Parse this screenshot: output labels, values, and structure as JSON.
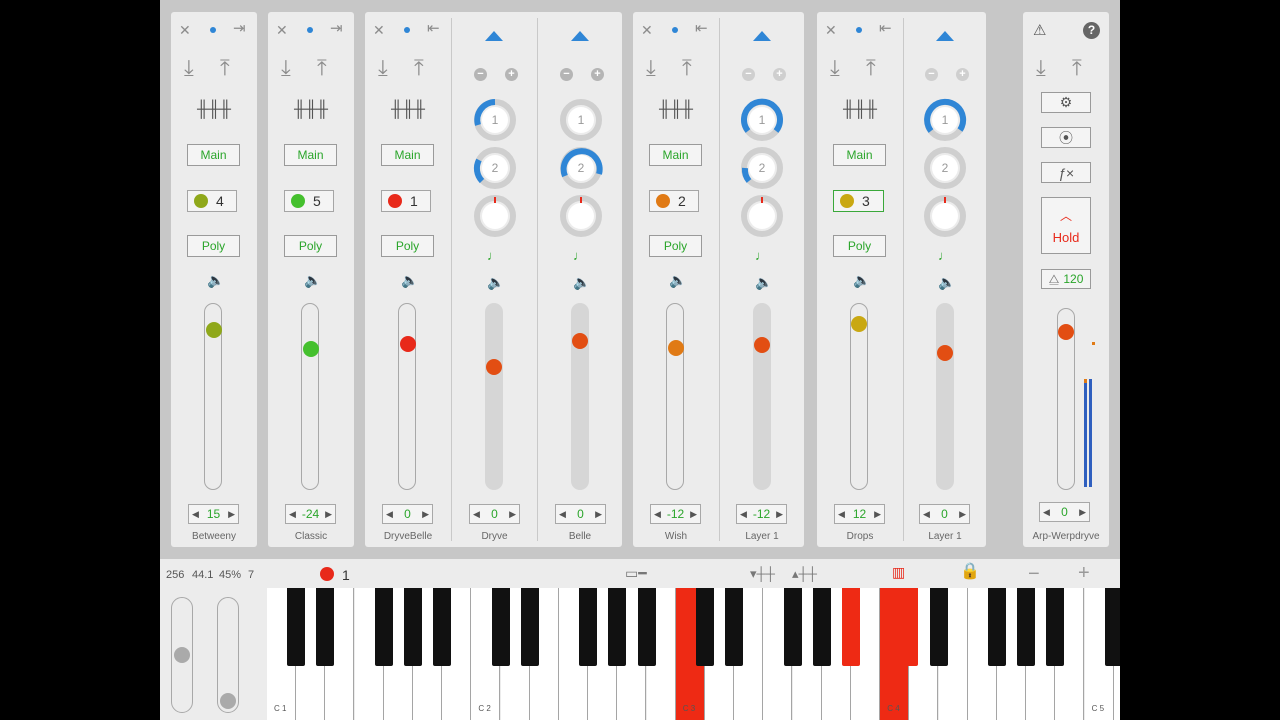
{
  "strips": [
    {
      "id": "betweeny",
      "name": "Betweeny",
      "output": "Main",
      "channel": "4",
      "channel_color": "#8fa81a",
      "mode": "Poly",
      "level": 0.83,
      "knob_color": "#8fa81a",
      "step": "15"
    },
    {
      "id": "classic",
      "name": "Classic",
      "output": "Main",
      "channel": "5",
      "channel_color": "#45c02e",
      "mode": "Poly",
      "level": 0.76,
      "knob_color": "#45c02e",
      "step": "-24"
    },
    {
      "id": "dryvebelle",
      "name": "DryveBelle",
      "output": "Main",
      "channel": "1",
      "channel_color": "#e8291a",
      "mode": "Poly",
      "level": 0.77,
      "knob_color": "#e8291a",
      "step": "0"
    },
    {
      "id": "wish",
      "name": "Wish",
      "output": "Main",
      "channel": "2",
      "channel_color": "#e07a15",
      "mode": "Poly",
      "level": 0.75,
      "knob_color": "#e07a15",
      "step": "-12"
    },
    {
      "id": "drops",
      "name": "Drops",
      "output": "Main",
      "channel": "3",
      "channel_color": "#c9a812",
      "mode": "Poly",
      "level": 0.88,
      "knob_color": "#c9a812",
      "step": "12",
      "selected": true
    }
  ],
  "layers": [
    {
      "id": "dryve",
      "name": "Dryve",
      "knob1": "1",
      "knob2": "2",
      "level": 0.67,
      "step": "0"
    },
    {
      "id": "belle",
      "name": "Belle",
      "knob1": "1",
      "knob2": "2",
      "level": 0.79,
      "step": "0"
    },
    {
      "id": "layer1a",
      "name": "Layer 1",
      "knob1": "1",
      "knob2": "2",
      "level": 0.79,
      "step": "-12"
    },
    {
      "id": "layer1b",
      "name": "Layer 1",
      "knob1": "1",
      "knob2": "2",
      "level": 0.74,
      "step": "0"
    }
  ],
  "arp": {
    "name": "Arp-Werpdryve",
    "hold_label": "Hold",
    "tempo": "120",
    "level": 0.87,
    "step": "0"
  },
  "status": {
    "buffer": "256",
    "rate": "44.1",
    "cpu": "45%",
    "voices": "7",
    "channel": "1",
    "channel_color": "#e8291a"
  },
  "keyboard": {
    "labels": [
      "C 1",
      "C 2",
      "C 3",
      "C 4",
      "C 5"
    ],
    "active_notes": [
      "C3",
      "C4",
      "A#3",
      "C#4"
    ]
  },
  "colors": {
    "accent_blue": "#2f86d6",
    "green": "#2aa52a",
    "red": "#ee2a14"
  }
}
